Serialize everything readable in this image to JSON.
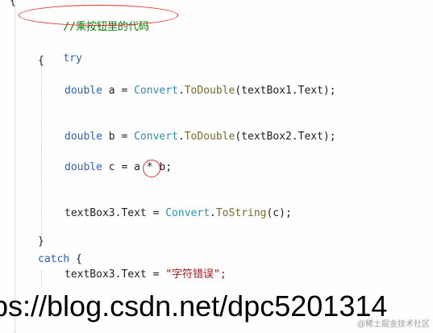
{
  "editor": {
    "comment": "//乘按钮里的代码",
    "try_keyword": "try",
    "open_brace": "{",
    "close_brace": "}",
    "top_brace": "{",
    "line_a": {
      "type": "double",
      "var": "a",
      "eq": "=",
      "cls": "Convert",
      "dot": ".",
      "method": "ToDouble",
      "arg": "(textBox1.Text);"
    },
    "line_b": {
      "type": "double",
      "var": "b",
      "eq": "=",
      "cls": "Convert",
      "dot": ".",
      "method": "ToDouble",
      "arg": "(textBox2.Text);"
    },
    "line_c": {
      "type": "double",
      "left": "c = a",
      "op": "*",
      "right": "b;"
    },
    "line_out": {
      "target": "textBox3.Text =",
      "cls": "Convert",
      "dot": ".",
      "method": "ToString",
      "arg": "(c);"
    },
    "catch_keyword": "catch",
    "catch_brace": "{",
    "line_err": {
      "target": "textBox3.Text =",
      "string": "\"字符错误\";"
    }
  },
  "watermark": {
    "url": "ps://blog.csdn.net/dpc5201314",
    "credit": "@稀土掘金技术社区"
  },
  "colors": {
    "keyword": "#2b5fbf",
    "class": "#2b91af",
    "method": "#7a6a2a",
    "string": "#a31515",
    "comment": "#008000",
    "annotation": "#e0302a"
  }
}
